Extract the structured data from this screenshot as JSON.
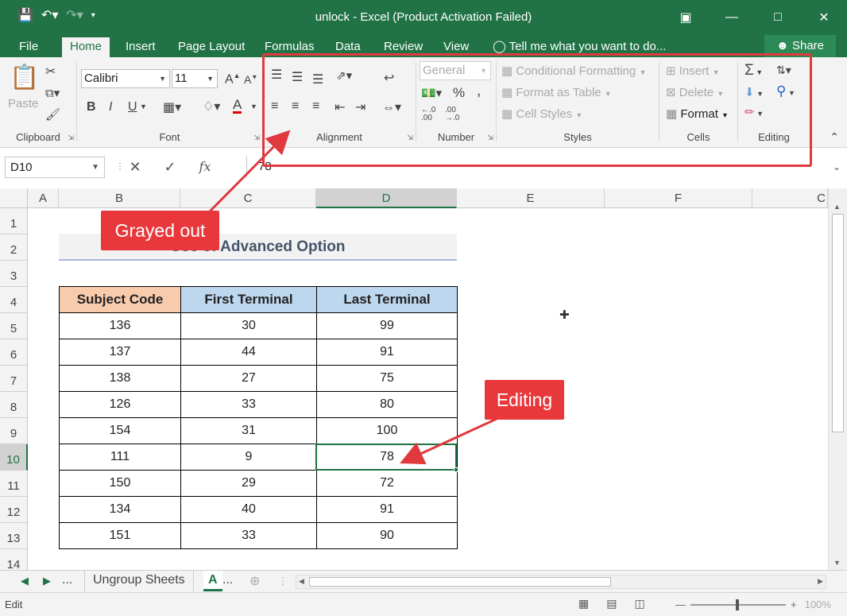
{
  "window": {
    "title": "unlock - Excel (Product Activation Failed)",
    "qat": {
      "save_icon": "save-icon",
      "undo_icon": "undo-icon",
      "redo_icon": "redo-icon"
    },
    "controls": [
      "ribbon-display-icon",
      "minimize-icon",
      "maximize-icon",
      "close-icon"
    ]
  },
  "tabs": [
    {
      "label": "File"
    },
    {
      "label": "Home"
    },
    {
      "label": "Insert"
    },
    {
      "label": "Page Layout"
    },
    {
      "label": "Formulas"
    },
    {
      "label": "Data"
    },
    {
      "label": "Review"
    },
    {
      "label": "View"
    }
  ],
  "active_tab": "Home",
  "tell_me": "Tell me what you want to do...",
  "share": "Share",
  "ribbon": {
    "clipboard": {
      "label": "Clipboard",
      "paste": "Paste"
    },
    "font": {
      "label": "Font",
      "name": "Calibri",
      "size": "11",
      "bold": "B",
      "italic": "I",
      "underline": "U",
      "grow": "A",
      "shrink": "A"
    },
    "alignment": {
      "label": "Alignment"
    },
    "number": {
      "label": "Number",
      "format": "General",
      "percent": "%",
      "comma": ","
    },
    "styles": {
      "label": "Styles",
      "conditional": "Conditional Formatting",
      "table": "Format as Table",
      "cell_styles": "Cell Styles"
    },
    "cells": {
      "label": "Cells",
      "insert": "Insert",
      "delete": "Delete",
      "format": "Format"
    },
    "editing": {
      "label": "Editing",
      "sigma": "Σ"
    }
  },
  "formula_bar": {
    "name_box": "D10",
    "value": "78",
    "fx": "fx"
  },
  "columns": [
    "A",
    "B",
    "C",
    "D",
    "E",
    "F",
    "C"
  ],
  "rows": [
    "1",
    "2",
    "3",
    "4",
    "5",
    "6",
    "7",
    "8",
    "9",
    "10",
    "11",
    "12",
    "13",
    "14"
  ],
  "sheet": {
    "title": "Use of Advanced Option",
    "headers": [
      "Subject Code",
      "First Terminal",
      "Last Terminal"
    ],
    "rows": [
      [
        "136",
        "30",
        "99"
      ],
      [
        "137",
        "44",
        "91"
      ],
      [
        "138",
        "27",
        "75"
      ],
      [
        "126",
        "33",
        "80"
      ],
      [
        "154",
        "31",
        "100"
      ],
      [
        "111",
        "9",
        "78"
      ],
      [
        "150",
        "29",
        "72"
      ],
      [
        "134",
        "40",
        "91"
      ],
      [
        "151",
        "33",
        "90"
      ]
    ]
  },
  "callouts": {
    "grayed": "Grayed out",
    "editing": "Editing"
  },
  "sheet_tabs": {
    "ellipsis": "...",
    "ungroup": "Ungroup Sheets",
    "active": "A",
    "more": "..."
  },
  "status": {
    "mode": "Edit",
    "zoom": "100%"
  },
  "colors": {
    "excel_green": "#217346",
    "callout_red": "#e8383c",
    "header_orange": "#f8cbad",
    "header_blue": "#bdd7ee"
  }
}
